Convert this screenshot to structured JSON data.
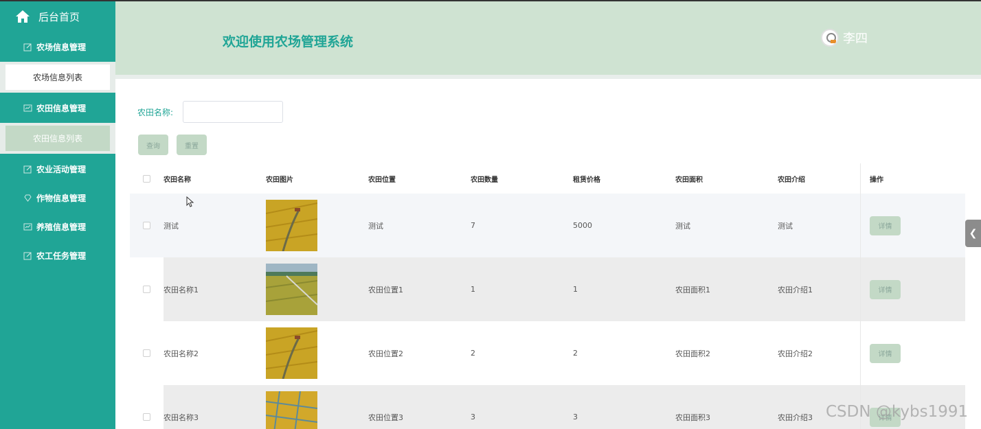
{
  "sidebar": {
    "home_label": "后台首页",
    "groups": [
      {
        "label": "农场信息管理",
        "sub": "农场信息列表"
      },
      {
        "label": "农田信息管理",
        "sub": "农田信息列表"
      },
      {
        "label": "农业活动管理"
      },
      {
        "label": "作物信息管理"
      },
      {
        "label": "养殖信息管理"
      },
      {
        "label": "农工任务管理"
      }
    ]
  },
  "header": {
    "title": "欢迎使用农场管理系统",
    "user_name": "李四"
  },
  "search": {
    "label": "农田名称:",
    "value": "",
    "query_button": "查询",
    "reset_button": "重置"
  },
  "table": {
    "columns": [
      "农田名称",
      "农田图片",
      "农田位置",
      "农田数量",
      "租赁价格",
      "农田面积",
      "农田介绍",
      "操作"
    ],
    "rows": [
      {
        "name": "测试",
        "location": "测试",
        "quantity": "7",
        "price": "5000",
        "area": "测试",
        "intro": "测试",
        "action": "详情"
      },
      {
        "name": "农田名称1",
        "location": "农田位置1",
        "quantity": "1",
        "price": "1",
        "area": "农田面积1",
        "intro": "农田介绍1",
        "action": "详情"
      },
      {
        "name": "农田名称2",
        "location": "农田位置2",
        "quantity": "2",
        "price": "2",
        "area": "农田面积2",
        "intro": "农田介绍2",
        "action": "详情"
      },
      {
        "name": "农田名称3",
        "location": "农田位置3",
        "quantity": "3",
        "price": "3",
        "area": "农田面积3",
        "intro": "农田介绍3",
        "action": "详情"
      }
    ]
  },
  "watermark": "CSDN @kybs1991",
  "colors": {
    "sidebar": "#20a596",
    "header": "#cfe3d2",
    "button": "#c3d9c6",
    "accent_text": "#20a596"
  }
}
